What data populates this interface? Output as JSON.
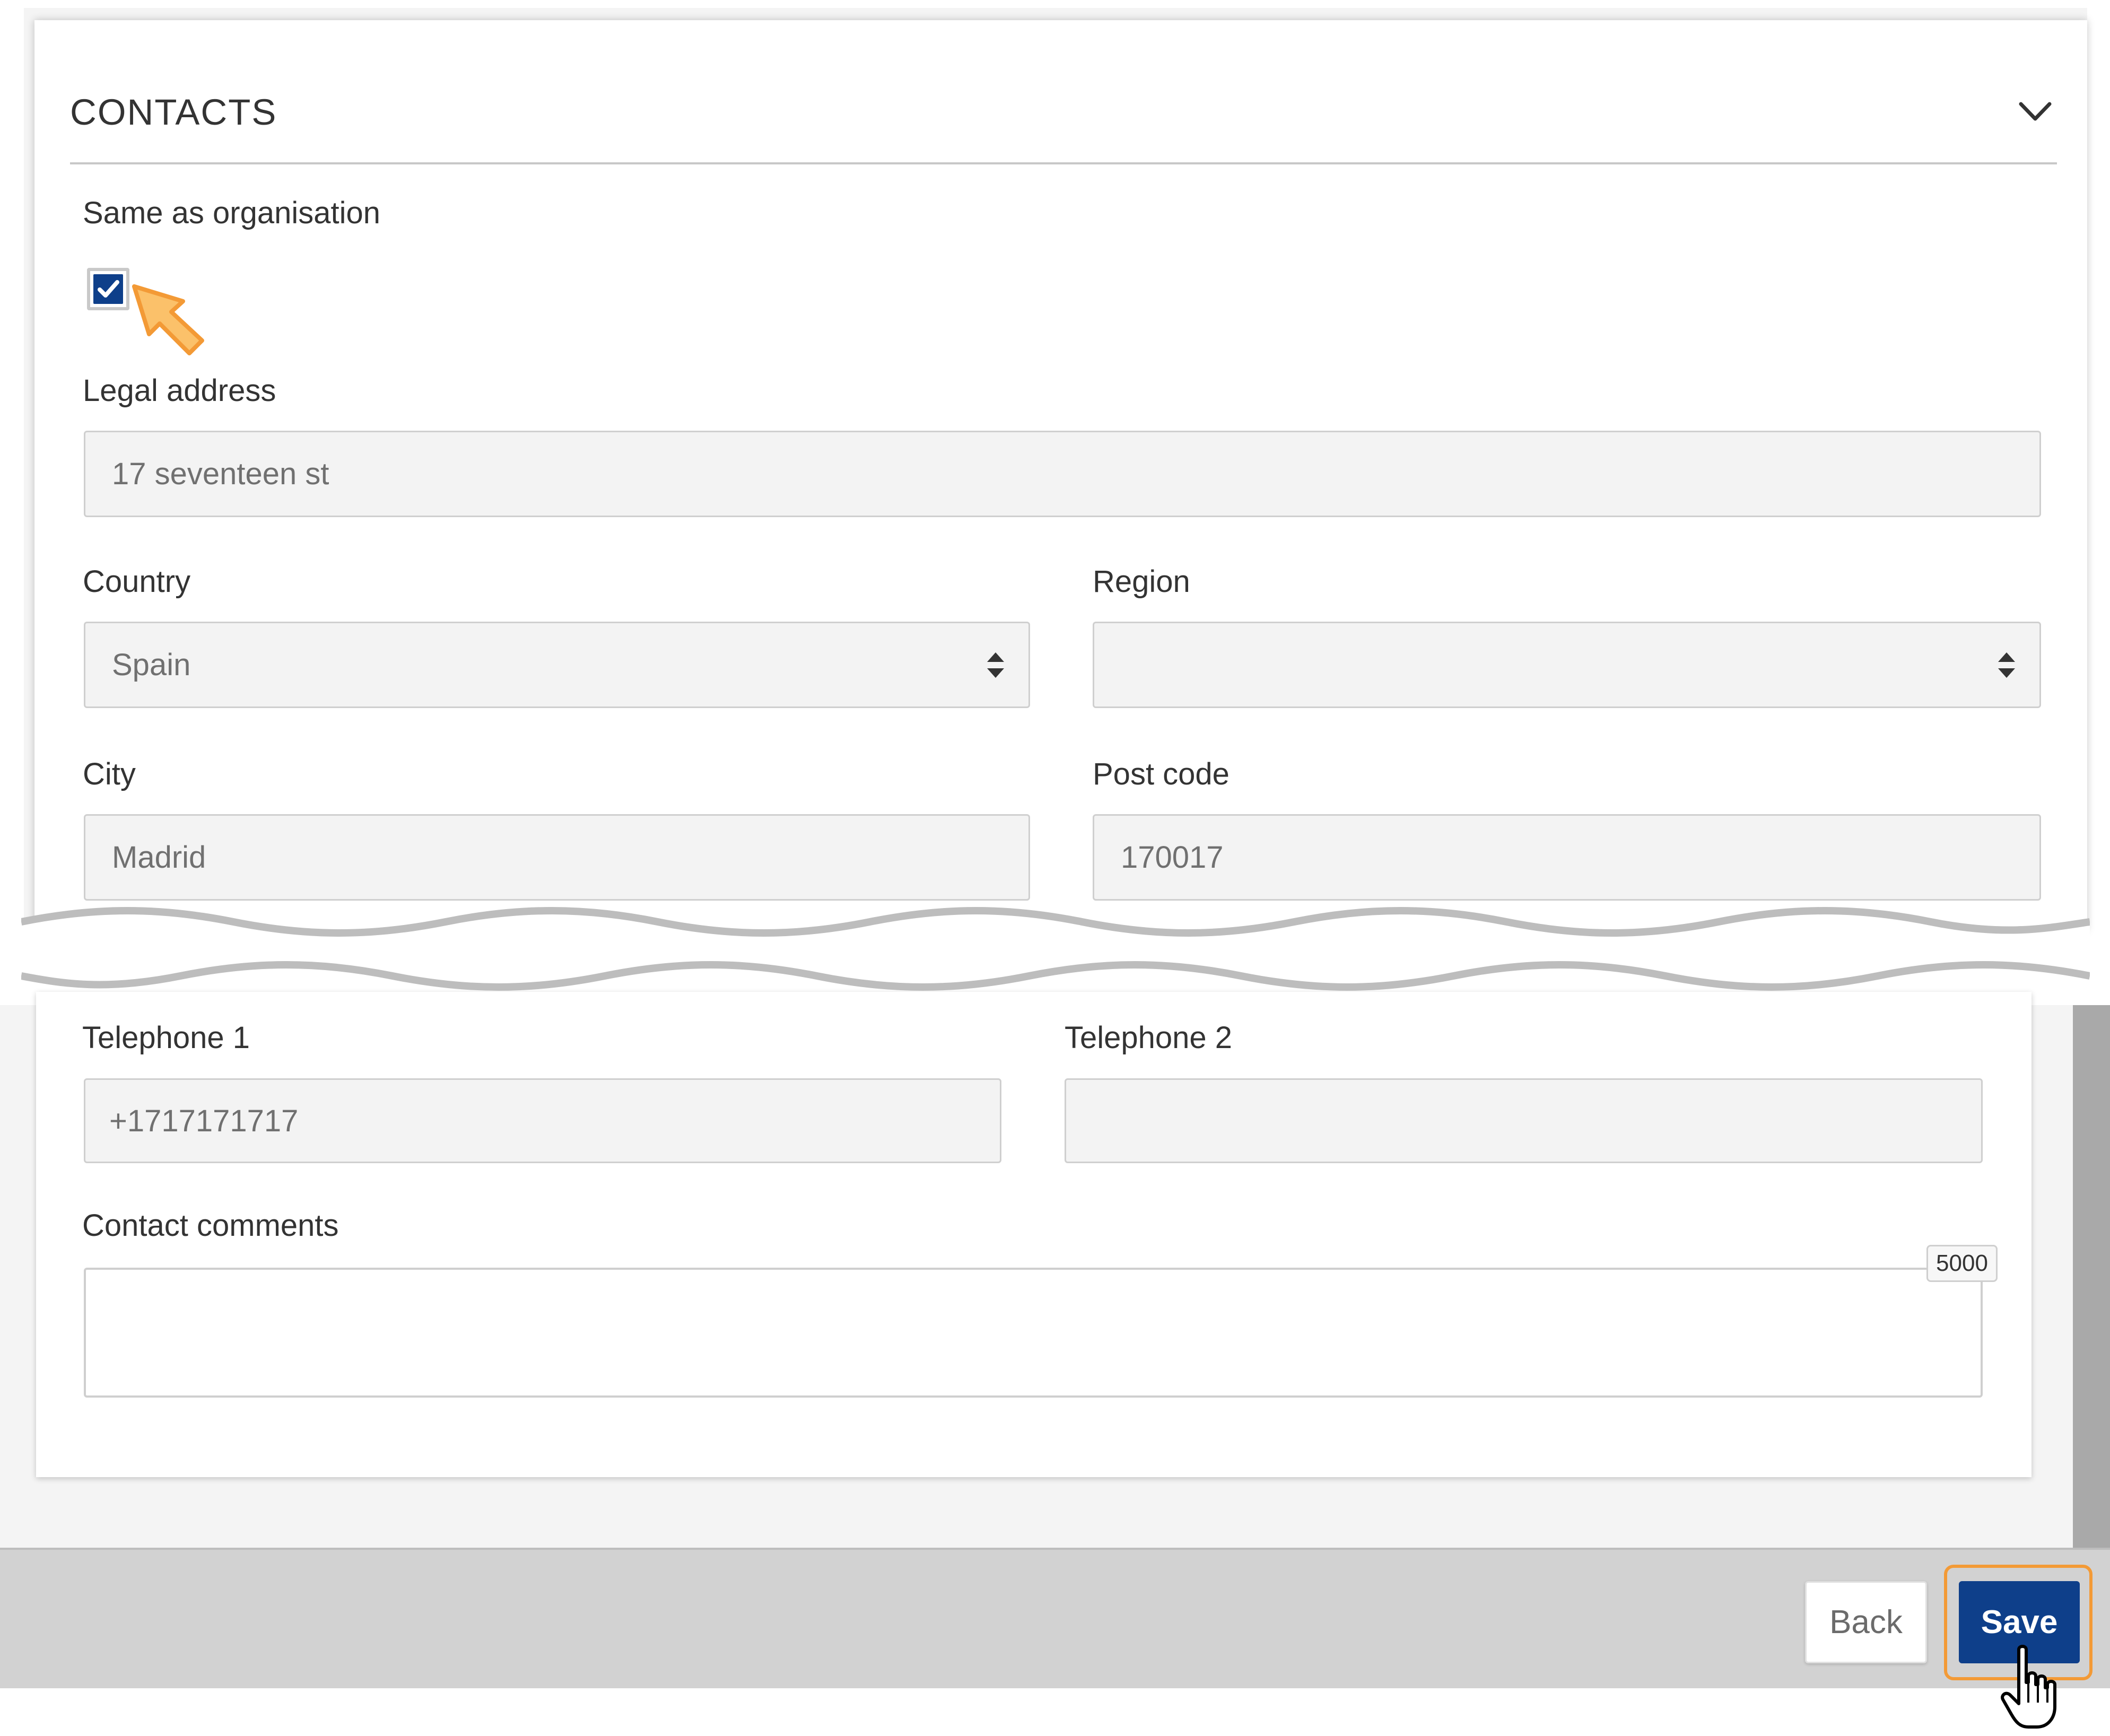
{
  "contacts_section": {
    "title": "CONTACTS",
    "same_as_org_label": "Same as organisation",
    "same_as_org_checked": true,
    "legal_address": {
      "label": "Legal address",
      "value": "17 seventeen st"
    },
    "country": {
      "label": "Country",
      "value": "Spain"
    },
    "region": {
      "label": "Region",
      "value": ""
    },
    "city": {
      "label": "City",
      "value": "Madrid"
    },
    "post_code": {
      "label": "Post code",
      "value": "170017"
    },
    "telephone_1": {
      "label": "Telephone 1",
      "value": "+1717171717"
    },
    "telephone_2": {
      "label": "Telephone 2",
      "value": ""
    },
    "contact_comments": {
      "label": "Contact comments",
      "value": "",
      "char_limit": "5000"
    }
  },
  "footer": {
    "back_label": "Back",
    "save_label": "Save"
  },
  "colors": {
    "primary": "#0e3f8a",
    "highlight": "#f39a36",
    "field_bg": "#f3f3f3",
    "footer_bg": "#d2d2d2"
  },
  "icons": [
    "chevron-down-icon",
    "checkmark-icon",
    "pointer-arrow-icon",
    "select-arrows-icon",
    "hand-cursor-icon"
  ]
}
